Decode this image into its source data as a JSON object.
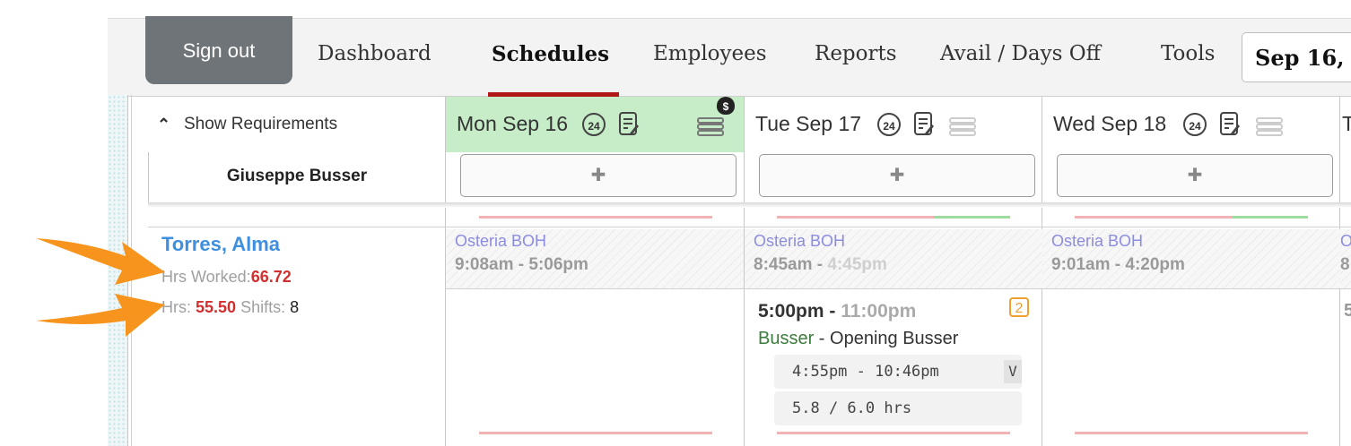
{
  "nav": {
    "sign_out": "Sign out",
    "items": [
      "Dashboard",
      "Schedules",
      "Employees",
      "Reports",
      "Avail / Days Off",
      "Tools"
    ],
    "active": "Schedules",
    "date_value": "Sep 16,"
  },
  "header": {
    "show_requirements": "Show Requirements",
    "position_name": "Giuseppe Busser",
    "add_symbol": "✚",
    "days": [
      {
        "label": "Mon Sep 16",
        "today": true,
        "badge": "24"
      },
      {
        "label": "Tue Sep 17",
        "today": false,
        "badge": "24"
      },
      {
        "label": "Wed Sep 18",
        "today": false,
        "badge": "24"
      },
      {
        "label": "T",
        "today": false,
        "badge": ""
      }
    ]
  },
  "employee": {
    "name": "Torres, Alma",
    "hrs_worked_label": "Hrs Worked:",
    "hrs_worked": "66.72",
    "hrs_label": "Hrs:",
    "hrs": "55.50",
    "shifts_label": "Shifts:",
    "shifts": "8"
  },
  "availability": [
    {
      "location": "Osteria BOH",
      "start": "9:08am - 5:06pm",
      "end": ""
    },
    {
      "location": "Osteria BOH",
      "start": "8:45am - ",
      "end": "4:45pm"
    },
    {
      "location": "Osteria BOH",
      "start": "9:01am - 4:20pm",
      "end": ""
    },
    {
      "location": "O",
      "start": "8",
      "end": ""
    }
  ],
  "shift": {
    "start": "5:00pm - ",
    "end": "11:00pm",
    "count": "2",
    "position": "Busser",
    "separator": " - ",
    "description": "Opening Busser",
    "punch": "4:55pm - 10:46pm",
    "punch_flag": "V",
    "hours": "5.8 / 6.0 hrs",
    "partial_next": "5"
  },
  "colors": {
    "today_bg": "#c6ecc8",
    "accent_red": "#d32f2f",
    "link_blue": "#3f8fe0",
    "arrow_orange": "#f7941d"
  }
}
